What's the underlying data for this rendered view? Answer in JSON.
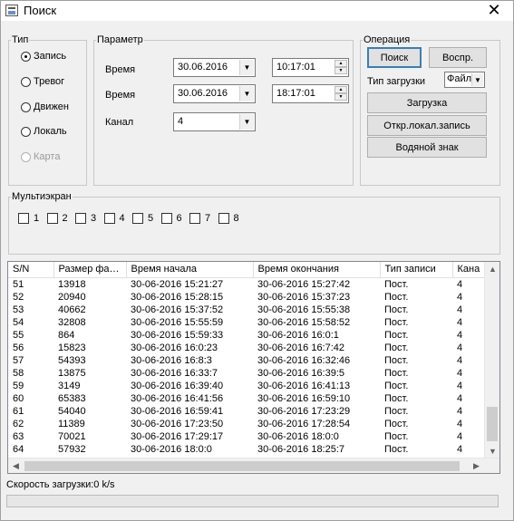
{
  "window": {
    "title": "Поиск",
    "close_glyph": "✕"
  },
  "type_group": {
    "legend": "Тип",
    "options": [
      {
        "label": "Запись",
        "selected": true,
        "enabled": true
      },
      {
        "label": "Тревог",
        "selected": false,
        "enabled": true
      },
      {
        "label": "Движен",
        "selected": false,
        "enabled": true
      },
      {
        "label": "Локаль",
        "selected": false,
        "enabled": true
      },
      {
        "label": "Карта",
        "selected": false,
        "enabled": false
      }
    ]
  },
  "param_group": {
    "legend": "Параметр",
    "start_label": "Время",
    "start_date": "30.06.2016",
    "start_time": "10:17:01",
    "end_label": "Время",
    "end_date": "30.06.2016",
    "end_time": "18:17:01",
    "channel_label": "Канал",
    "channel_value": "4"
  },
  "op_group": {
    "legend": "Операция",
    "search_label": "Поиск",
    "play_label": "Воспр.",
    "download_type_label": "Тип загрузки",
    "download_type_value": "Файл",
    "download_label": "Загрузка",
    "open_local_label": "Откр.локал.запись",
    "watermark_label": "Водяной знак"
  },
  "multiscreen": {
    "legend": "Мультиэкран",
    "items": [
      "1",
      "2",
      "3",
      "4",
      "5",
      "6",
      "7",
      "8"
    ]
  },
  "table": {
    "columns": [
      "S/N",
      "Размер фа…",
      "Время начала",
      "Время окончания",
      "Тип записи",
      "Кана"
    ],
    "rows": [
      [
        "51",
        "13918",
        "30-06-2016 15:21:27",
        "30-06-2016 15:27:42",
        "Пост.",
        "4"
      ],
      [
        "52",
        "20940",
        "30-06-2016 15:28:15",
        "30-06-2016 15:37:23",
        "Пост.",
        "4"
      ],
      [
        "53",
        "40662",
        "30-06-2016 15:37:52",
        "30-06-2016 15:55:38",
        "Пост.",
        "4"
      ],
      [
        "54",
        "32808",
        "30-06-2016 15:55:59",
        "30-06-2016 15:58:52",
        "Пост.",
        "4"
      ],
      [
        "55",
        "864",
        "30-06-2016 15:59:33",
        "30-06-2016 16:0:1",
        "Пост.",
        "4"
      ],
      [
        "56",
        "15823",
        "30-06-2016 16:0:23",
        "30-06-2016 16:7:42",
        "Пост.",
        "4"
      ],
      [
        "57",
        "54393",
        "30-06-2016 16:8:3",
        "30-06-2016 16:32:46",
        "Пост.",
        "4"
      ],
      [
        "58",
        "13875",
        "30-06-2016 16:33:7",
        "30-06-2016 16:39:5",
        "Пост.",
        "4"
      ],
      [
        "59",
        "3149",
        "30-06-2016 16:39:40",
        "30-06-2016 16:41:13",
        "Пост.",
        "4"
      ],
      [
        "60",
        "65383",
        "30-06-2016 16:41:56",
        "30-06-2016 16:59:10",
        "Пост.",
        "4"
      ],
      [
        "61",
        "54040",
        "30-06-2016 16:59:41",
        "30-06-2016 17:23:29",
        "Пост.",
        "4"
      ],
      [
        "62",
        "11389",
        "30-06-2016 17:23:50",
        "30-06-2016 17:28:54",
        "Пост.",
        "4"
      ],
      [
        "63",
        "70021",
        "30-06-2016 17:29:17",
        "30-06-2016 18:0:0",
        "Пост.",
        "4"
      ],
      [
        "64",
        "57932",
        "30-06-2016 18:0:0",
        "30-06-2016 18:25:7",
        "Пост.",
        "4"
      ]
    ]
  },
  "status": {
    "speed_text": "Скорость загрузки:0 k/s",
    "progress": 0
  }
}
